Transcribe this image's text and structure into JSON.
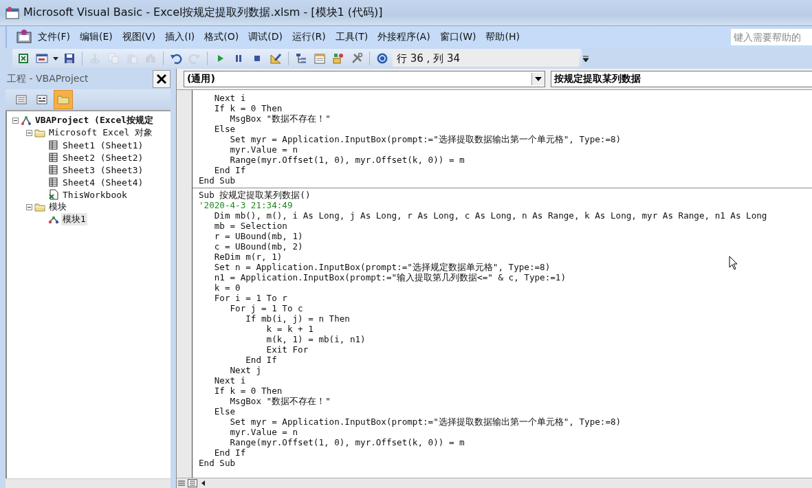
{
  "window": {
    "title": "Microsoft Visual Basic - Excel按规定提取列数据.xlsm - [模块1 (代码)]"
  },
  "menu_bar": {
    "items": [
      "文件(F)",
      "编辑(E)",
      "视图(V)",
      "插入(I)",
      "格式(O)",
      "调试(D)",
      "运行(R)",
      "工具(T)",
      "外接程序(A)",
      "窗口(W)",
      "帮助(H)"
    ]
  },
  "help_search": {
    "placeholder": "键入需要帮助的"
  },
  "toolbar": {
    "buttons": [
      {
        "kind": "excel",
        "disabled": false
      },
      {
        "kind": "insert_form",
        "disabled": false
      },
      {
        "kind": "save",
        "disabled": false
      },
      {
        "kind": "separator"
      },
      {
        "kind": "cut",
        "disabled": true
      },
      {
        "kind": "copy",
        "disabled": true
      },
      {
        "kind": "paste",
        "disabled": true
      },
      {
        "kind": "find",
        "disabled": true
      },
      {
        "kind": "separator"
      },
      {
        "kind": "undo",
        "disabled": false
      },
      {
        "kind": "redo",
        "disabled": true
      },
      {
        "kind": "separator"
      },
      {
        "kind": "run",
        "disabled": false
      },
      {
        "kind": "pause",
        "disabled": false
      },
      {
        "kind": "stop",
        "disabled": false
      },
      {
        "kind": "design",
        "disabled": false
      },
      {
        "kind": "separator"
      },
      {
        "kind": "explorer",
        "disabled": false
      },
      {
        "kind": "properties",
        "disabled": false
      },
      {
        "kind": "browser",
        "disabled": false
      },
      {
        "kind": "toolbox",
        "disabled": false
      },
      {
        "kind": "separator"
      },
      {
        "kind": "help",
        "disabled": false
      }
    ],
    "position": "行 36 , 列 34"
  },
  "project_panel": {
    "title": "工程 - VBAProject",
    "buttons": [
      {
        "kind": "view_code",
        "selected": false
      },
      {
        "kind": "view_object",
        "selected": false
      },
      {
        "kind": "toggle_folders",
        "selected": true
      }
    ],
    "tree": [
      {
        "label": "VBAProject (Excel按规定",
        "kind": "project",
        "expanded": true,
        "selected": false,
        "children": [
          {
            "label": "Microsoft Excel 对象",
            "kind": "folder",
            "expanded": true,
            "selected": false,
            "children": [
              {
                "label": "Sheet1 (Sheet1)",
                "kind": "sheet",
                "selected": false
              },
              {
                "label": "Sheet2 (Sheet2)",
                "kind": "sheet",
                "selected": false
              },
              {
                "label": "Sheet3 (Sheet3)",
                "kind": "sheet",
                "selected": false
              },
              {
                "label": "Sheet4 (Sheet4)",
                "kind": "sheet",
                "selected": false
              },
              {
                "label": "ThisWorkbook",
                "kind": "workbook",
                "selected": false
              }
            ]
          },
          {
            "label": "模块",
            "kind": "folder",
            "expanded": true,
            "selected": false,
            "children": [
              {
                "label": "模块1",
                "kind": "module",
                "selected": true
              }
            ]
          }
        ]
      }
    ]
  },
  "code_window": {
    "object_dropdown": "(通用)",
    "procedure_dropdown": "按规定提取某列数据",
    "procedures": [
      {
        "lines": [
          {
            "text": "   Next i",
            "kind": "code"
          },
          {
            "text": "   If k = 0 Then",
            "kind": "code"
          },
          {
            "text": "      MsgBox \"数据不存在！\"",
            "kind": "code"
          },
          {
            "text": "   Else",
            "kind": "code"
          },
          {
            "text": "      Set myr = Application.InputBox(prompt:=\"选择提取数据输出第一个单元格\", Type:=8)",
            "kind": "code"
          },
          {
            "text": "      myr.Value = n",
            "kind": "code"
          },
          {
            "text": "      Range(myr.Offset(1, 0), myr.Offset(k, 0)) = m",
            "kind": "code"
          },
          {
            "text": "   End If",
            "kind": "code"
          },
          {
            "text": "End Sub",
            "kind": "code"
          }
        ]
      },
      {
        "lines": [
          {
            "text": "Sub 按规定提取某列数据()",
            "kind": "code"
          },
          {
            "text": "'2020-4-3 21:34:49",
            "kind": "comment"
          },
          {
            "text": "   Dim mb(), m(), i As Long, j As Long, r As Long, c As Long, n As Range, k As Long, myr As Range, n1 As Long",
            "kind": "code"
          },
          {
            "text": "   mb = Selection",
            "kind": "code"
          },
          {
            "text": "   r = UBound(mb, 1)",
            "kind": "code"
          },
          {
            "text": "   c = UBound(mb, 2)",
            "kind": "code"
          },
          {
            "text": "   ReDim m(r, 1)",
            "kind": "code"
          },
          {
            "text": "   Set n = Application.InputBox(prompt:=\"选择规定数据单元格\", Type:=8)",
            "kind": "code"
          },
          {
            "text": "   n1 = Application.InputBox(prompt:=\"输入提取第几列数据<=\" & c, Type:=1)",
            "kind": "code"
          },
          {
            "text": "   k = 0",
            "kind": "code"
          },
          {
            "text": "   For i = 1 To r",
            "kind": "code"
          },
          {
            "text": "      For j = 1 To c",
            "kind": "code"
          },
          {
            "text": "         If mb(i, j) = n Then",
            "kind": "code"
          },
          {
            "text": "             k = k + 1",
            "kind": "code"
          },
          {
            "text": "             m(k, 1) = mb(i, n1)",
            "kind": "code"
          },
          {
            "text": "             Exit For",
            "kind": "code"
          },
          {
            "text": "         End If",
            "kind": "code"
          },
          {
            "text": "      Next j",
            "kind": "code"
          },
          {
            "text": "   Next i",
            "kind": "code"
          },
          {
            "text": "   If k = 0 Then",
            "kind": "code"
          },
          {
            "text": "      MsgBox \"数据不存在！\"",
            "kind": "code"
          },
          {
            "text": "   Else",
            "kind": "code"
          },
          {
            "text": "      Set myr = Application.InputBox(prompt:=\"选择提取数据输出第一个单元格\", Type:=8)",
            "kind": "code"
          },
          {
            "text": "      myr.Value = n",
            "kind": "code"
          },
          {
            "text": "      Range(myr.Offset(1, 0), myr.Offset(k, 0)) = m",
            "kind": "code"
          },
          {
            "text": "   End If",
            "kind": "code"
          },
          {
            "text": "End Sub",
            "kind": "code"
          }
        ]
      }
    ]
  }
}
